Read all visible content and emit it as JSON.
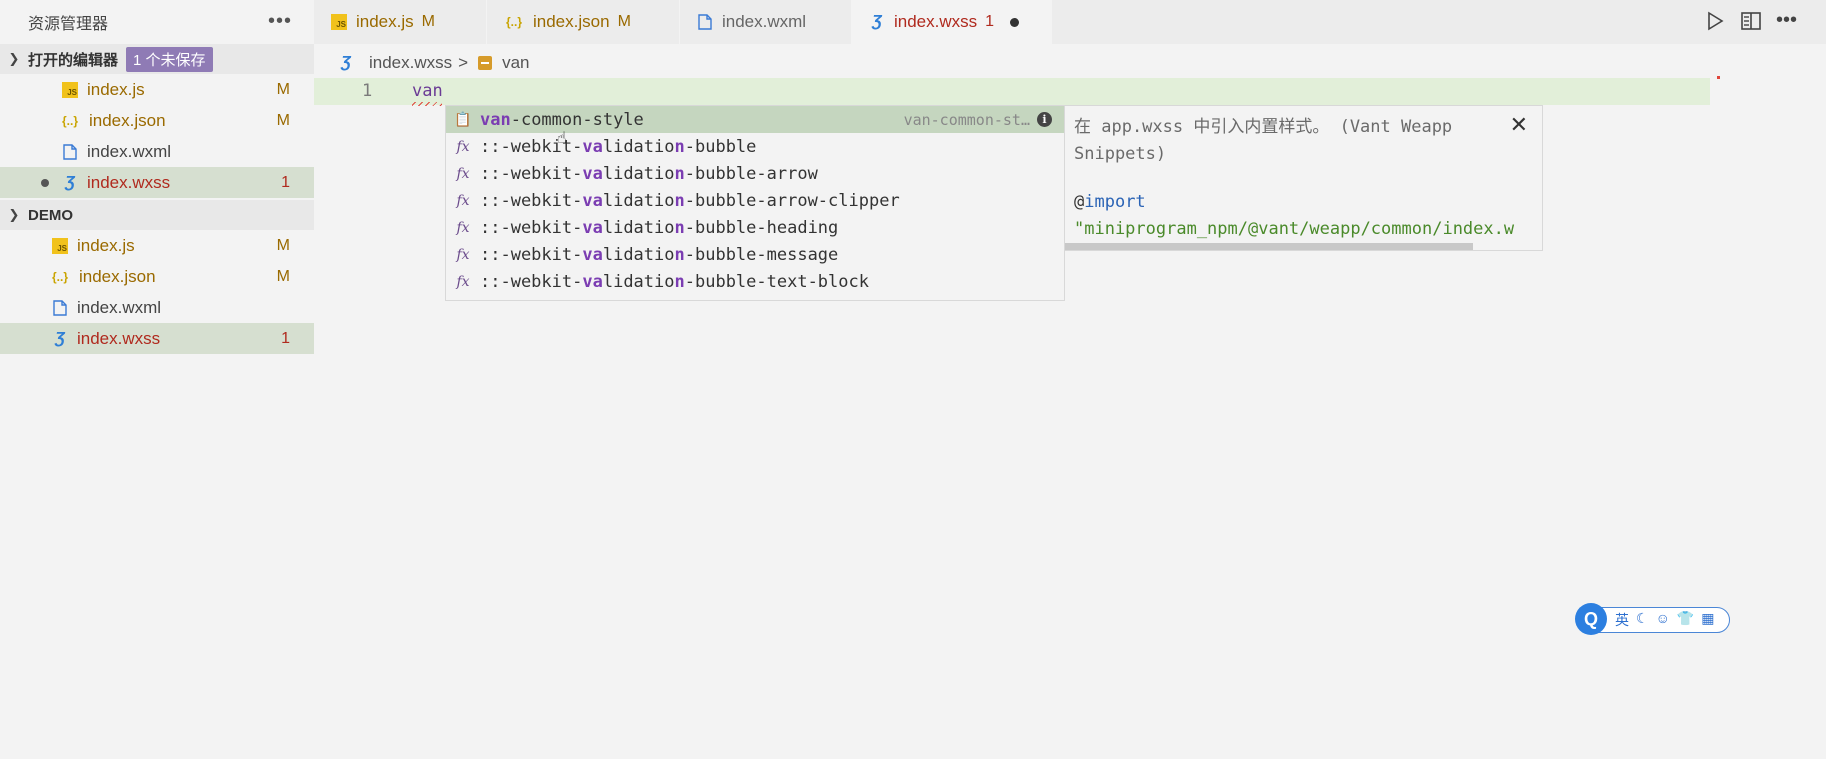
{
  "explorer": {
    "title": "资源管理器",
    "more_label": "•••",
    "open_editors": {
      "label": "打开的编辑器",
      "badge": "1 个未保存",
      "files": [
        {
          "name": "index.js",
          "status": "M"
        },
        {
          "name": "index.json",
          "status": "M"
        },
        {
          "name": "index.wxml",
          "status": ""
        },
        {
          "name": "index.wxss",
          "status": "1"
        }
      ]
    },
    "demo": {
      "label": "DEMO",
      "files": [
        {
          "name": "index.js",
          "status": "M"
        },
        {
          "name": "index.json",
          "status": "M"
        },
        {
          "name": "index.wxml",
          "status": ""
        },
        {
          "name": "index.wxss",
          "status": "1"
        }
      ]
    }
  },
  "tabs": [
    {
      "name": "index.js",
      "badge": "M"
    },
    {
      "name": "index.json",
      "badge": "M"
    },
    {
      "name": "index.wxml",
      "badge": ""
    },
    {
      "name": "index.wxss",
      "badge": "1"
    }
  ],
  "breadcrumb": {
    "file": "index.wxss",
    "separator": ">",
    "symbol": "van"
  },
  "editor": {
    "line_number": "1",
    "code": "van"
  },
  "suggestions": [
    {
      "match": "van",
      "rest": "-common-style",
      "detail": "van-common-st…",
      "kind": "snippet"
    },
    {
      "pre": "::-webkit-",
      "match1": "va",
      "mid": "lidatio",
      "match2": "n",
      "rest": "-bubble",
      "kind": "function"
    },
    {
      "pre": "::-webkit-",
      "match1": "va",
      "mid": "lidatio",
      "match2": "n",
      "rest": "-bubble-arrow",
      "kind": "function"
    },
    {
      "pre": "::-webkit-",
      "match1": "va",
      "mid": "lidatio",
      "match2": "n",
      "rest": "-bubble-arrow-clipper",
      "kind": "function"
    },
    {
      "pre": "::-webkit-",
      "match1": "va",
      "mid": "lidatio",
      "match2": "n",
      "rest": "-bubble-heading",
      "kind": "function"
    },
    {
      "pre": "::-webkit-",
      "match1": "va",
      "mid": "lidatio",
      "match2": "n",
      "rest": "-bubble-message",
      "kind": "function"
    },
    {
      "pre": "::-webkit-",
      "match1": "va",
      "mid": "lidatio",
      "match2": "n",
      "rest": "-bubble-text-block",
      "kind": "function"
    }
  ],
  "details": {
    "description": "在 app.wxss 中引入内置样式。 (Vant Weapp Snippets)",
    "at": "@",
    "keyword": "import",
    "path": "\"miniprogram_npm/@vant/weapp/common/index.w"
  },
  "ime": {
    "logo": "Q",
    "lang": "英",
    "moon": "☾",
    "emoji": "☺",
    "shirt": "👕",
    "grid": "▦"
  }
}
